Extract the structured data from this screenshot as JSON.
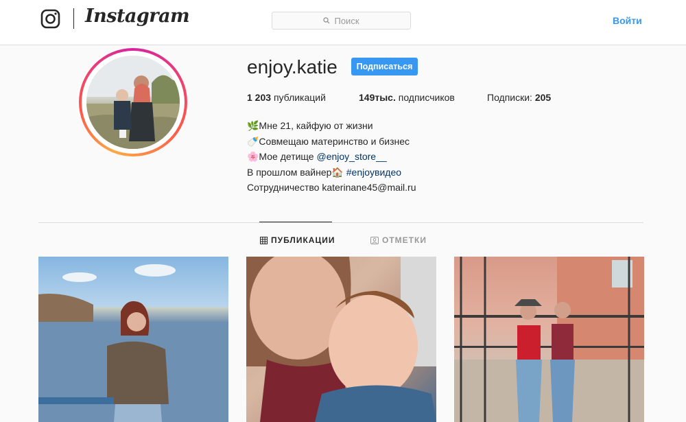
{
  "header": {
    "logo_alt": "Instagram",
    "search_placeholder": "Поиск",
    "login_label": "Войти"
  },
  "profile": {
    "username": "enjoy.katie",
    "follow_label": "Подписаться",
    "posts_count": "1 203",
    "posts_label": "публикаций",
    "followers_count": "149тыс.",
    "followers_label": "подписчиков",
    "following_label": "Подписки:",
    "following_count": "205",
    "bio": {
      "line1": "🌿Мне 21, кайфую от жизни",
      "line2": "🍼Совмещаю материнство и бизнес",
      "line3_prefix": "🌸Мое детище ",
      "line3_link": "@enjoy_store__",
      "line4_prefix": "В прошлом вайнер🏠 ",
      "line4_link": "#enjoyвидео",
      "line5": "Сотрудничество katerinane45@mail.ru"
    }
  },
  "tabs": {
    "posts": "ПУБЛИКАЦИИ",
    "tagged": "ОТМЕТКИ"
  },
  "colors": {
    "accent": "#3897f0",
    "link": "#003569",
    "border": "#dbdbdb"
  }
}
